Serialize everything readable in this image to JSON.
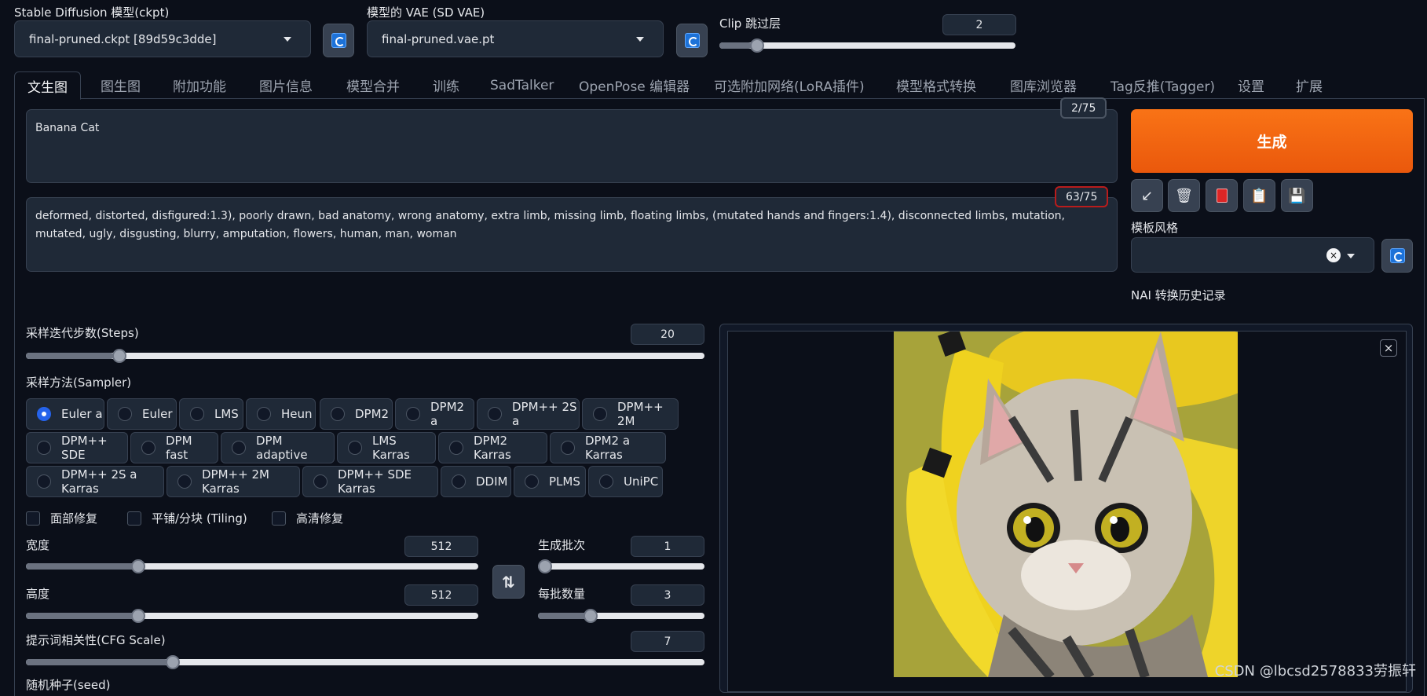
{
  "top": {
    "ckpt_label": "Stable Diffusion 模型(ckpt)",
    "ckpt_value": "final-pruned.ckpt [89d59c3dde]",
    "vae_label": "模型的 VAE (SD VAE)",
    "vae_value": "final-pruned.vae.pt",
    "clip_label": "Clip 跳过层",
    "clip_value": "2",
    "clip_fraction": 0.11
  },
  "tabs": [
    "文生图",
    "图生图",
    "附加功能",
    "图片信息",
    "模型合并",
    "训练",
    "SadTalker",
    "OpenPose 编辑器",
    "可选附加网络(LoRA插件)",
    "模型格式转换",
    "图库浏览器",
    "Tag反推(Tagger)",
    "设置",
    "扩展"
  ],
  "prompt": {
    "positive": "Banana Cat",
    "positive_count": "2/75",
    "negative": "deformed, distorted, disfigured:1.3), poorly drawn, bad anatomy, wrong anatomy, extra limb, missing limb, floating limbs, (mutated hands and fingers:1.4), disconnected limbs, mutation, mutated, ugly, disgusting, blurry, amputation, flowers, human, man, woman",
    "negative_count": "63/75"
  },
  "generate_label": "生成",
  "tool_icons": [
    "arrow-icon",
    "trash-icon",
    "red-card-icon",
    "clipboard-icon",
    "save-icon"
  ],
  "style": {
    "label": "模板风格",
    "nai_label": "NAI 转换历史记录"
  },
  "steps": {
    "label": "采样迭代步数(Steps)",
    "value": "20",
    "fraction": 0.13
  },
  "sampler": {
    "label": "采样方法(Sampler)",
    "options": [
      "Euler a",
      "Euler",
      "LMS",
      "Heun",
      "DPM2",
      "DPM2 a",
      "DPM++ 2S a",
      "DPM++ 2M",
      "DPM++ SDE",
      "DPM fast",
      "DPM adaptive",
      "LMS Karras",
      "DPM2 Karras",
      "DPM2 a Karras",
      "DPM++ 2S a Karras",
      "DPM++ 2M Karras",
      "DPM++ SDE Karras",
      "DDIM",
      "PLMS",
      "UniPC"
    ],
    "selected": "Euler a"
  },
  "checks": [
    "面部修复",
    "平铺/分块 (Tiling)",
    "高清修复"
  ],
  "width": {
    "label": "宽度",
    "value": "512",
    "fraction": 0.24
  },
  "height": {
    "label": "高度",
    "value": "512",
    "fraction": 0.24
  },
  "batch_count": {
    "label": "生成批次",
    "value": "1",
    "fraction": 0.0
  },
  "batch_size": {
    "label": "每批数量",
    "value": "3",
    "fraction": 0.3
  },
  "cfg": {
    "label": "提示词相关性(CFG Scale)",
    "value": "7",
    "fraction": 0.21
  },
  "seed_label": "随机种子(seed)",
  "watermark": "CSDN @lbcsd2578833劳振轩",
  "colors": {
    "accent": "#f97316",
    "bg": "#0b0f19",
    "panel": "#1f2937"
  }
}
